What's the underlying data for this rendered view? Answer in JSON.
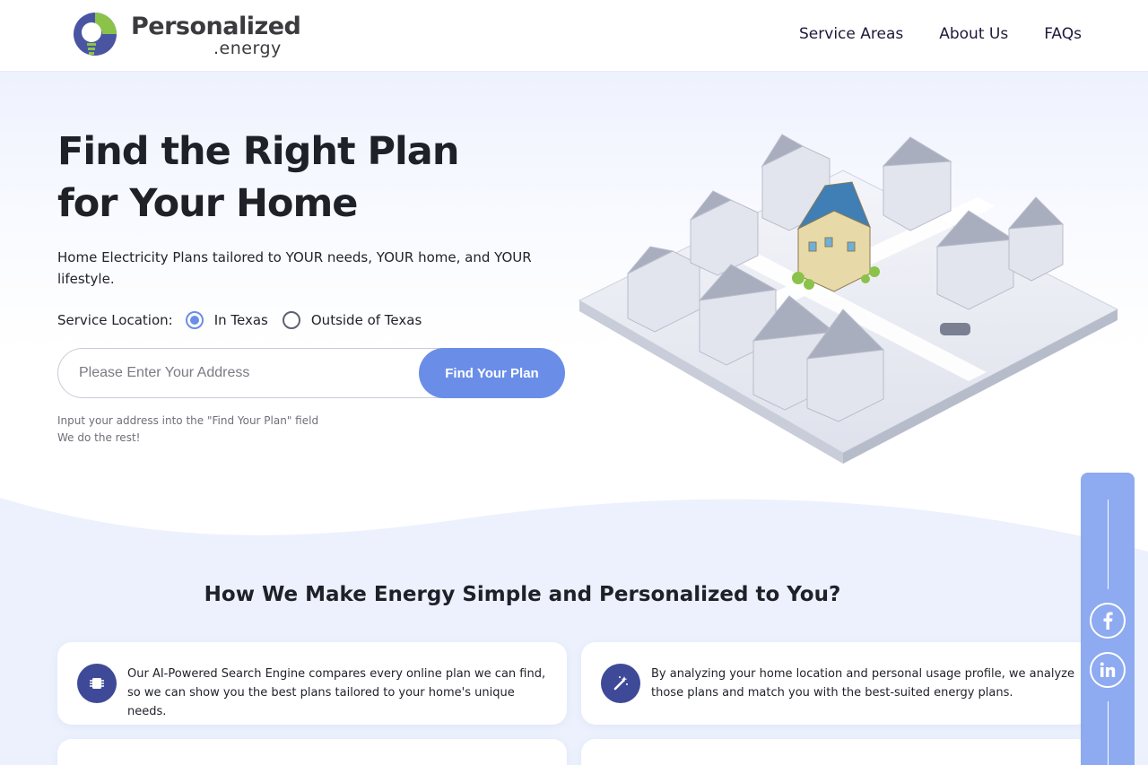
{
  "brand": {
    "name": "Personalized",
    "suffix": ".energy",
    "colors": {
      "blue": "#4a55a2",
      "green": "#8bc34a",
      "accent": "#6a8ee8"
    }
  },
  "nav": {
    "items": [
      {
        "label": "Service Areas"
      },
      {
        "label": "About Us"
      },
      {
        "label": "FAQs"
      }
    ]
  },
  "hero": {
    "title_line1": "Find the Right Plan",
    "title_line2": "for Your Home",
    "subtitle": "Home Electricity Plans tailored to YOUR needs, YOUR home, and YOUR lifestyle.",
    "location_label": "Service Location:",
    "location_options": [
      {
        "label": "In Texas",
        "selected": true
      },
      {
        "label": "Outside of Texas",
        "selected": false
      }
    ],
    "address_placeholder": "Please Enter Your Address",
    "button_label": "Find Your Plan",
    "hint_line1": "Input your address into the \"Find Your Plan\" field",
    "hint_line2": "We do the rest!"
  },
  "section": {
    "title": "How We Make Energy Simple and Personalized to You?",
    "cards": [
      {
        "icon": "chip-icon",
        "text": "Our AI-Powered Search Engine compares every online plan we can find, so we can show you the best plans tailored to your home's unique needs."
      },
      {
        "icon": "magic-wand-icon",
        "text": "By analyzing your home location and personal usage profile, we analyze those plans and match you with the best-suited energy plans."
      }
    ]
  },
  "social": {
    "items": [
      {
        "icon": "facebook-icon"
      },
      {
        "icon": "linkedin-icon"
      }
    ]
  }
}
